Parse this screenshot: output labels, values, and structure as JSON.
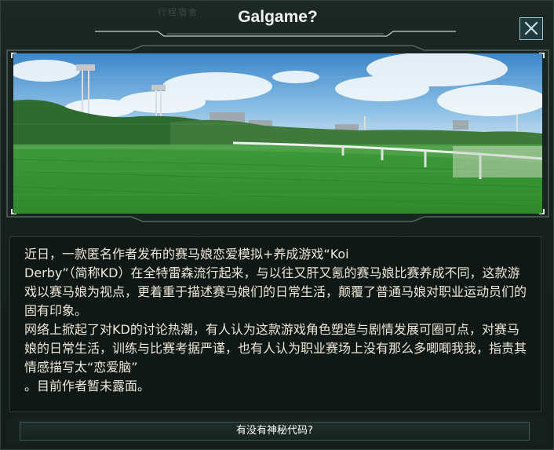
{
  "dialog": {
    "title": "Galgame?",
    "background_watermark": "行程宿舍",
    "close_label": "×",
    "close_icon": "close-icon"
  },
  "article": {
    "paragraph1": "近日，一款匿名作者发布的赛马娘恋爱模拟+养成游戏“Koi\nDerby”（简称KD）在全特雷森流行起来，与以往又肝又氪的赛马娘比赛养成不同，这款游戏以赛马娘为视点，更着重于描述赛马娘们的日常生活，颠覆了普通马娘对职业运动员们的固有印象。",
    "paragraph2": "网络上掀起了对KD的讨论热潮，有人认为这款游戏角色塑造与剧情发展可圈可点，对赛马娘的日常生活，训练与比赛考据严谨，也有人认为职业赛场上没有那么多唧唧我我，指责其情感描写太“恋爱脑”",
    "paragraph3": "。目前作者暂未露面。"
  },
  "actions": {
    "secret_code_button": "有没有神秘代码?"
  },
  "colors": {
    "accent": "#9fc6cc",
    "text": "#ece7da",
    "panel": "#101815"
  }
}
